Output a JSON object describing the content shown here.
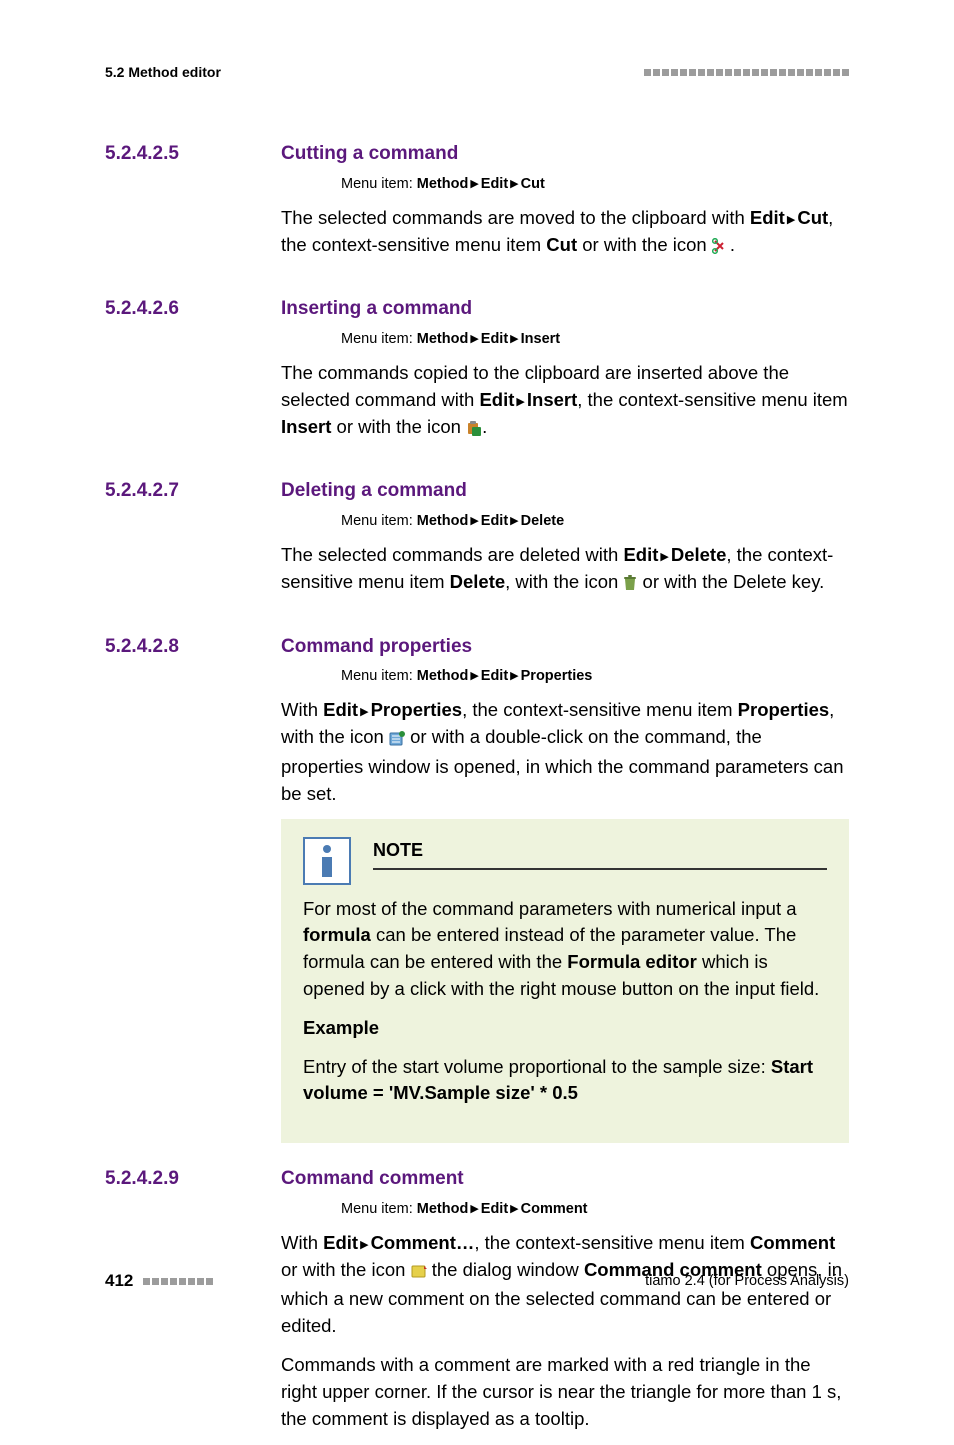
{
  "header": {
    "left": "5.2 Method editor"
  },
  "sections": [
    {
      "num": "5.2.4.2.5",
      "title": "Cutting a command",
      "menu": {
        "prefix": "Menu item:",
        "parts": [
          "Method",
          "Edit",
          "Cut"
        ]
      },
      "p1a": "The selected commands are moved to the clipboard with ",
      "p1b": "Edit",
      "p1c": "Cut",
      "p1d": ", the context-sensitive menu item ",
      "p1e": "Cut",
      "p1f": " or with the icon ",
      "p1g": "."
    },
    {
      "num": "5.2.4.2.6",
      "title": "Inserting a command",
      "menu": {
        "prefix": "Menu item:",
        "parts": [
          "Method",
          "Edit",
          "Insert"
        ]
      },
      "p1a": "The commands copied to the clipboard are inserted above the selected command with ",
      "p1b": "Edit",
      "p1c": "Insert",
      "p1d": ", the context-sensitive menu item ",
      "p1e": "Insert",
      "p1f": " or with the icon ",
      "p1g": "."
    },
    {
      "num": "5.2.4.2.7",
      "title": "Deleting a command",
      "menu": {
        "prefix": "Menu item:",
        "parts": [
          "Method",
          "Edit",
          "Delete"
        ]
      },
      "p1a": "The selected commands are deleted with ",
      "p1b": "Edit",
      "p1c": "Delete",
      "p1d": ", the context-sensitive menu item ",
      "p1e": "Delete",
      "p1f": ", with the icon ",
      "p1g": " or with the Delete key."
    },
    {
      "num": "5.2.4.2.8",
      "title": "Command properties",
      "menu": {
        "prefix": "Menu item:",
        "parts": [
          "Method",
          "Edit",
          "Properties"
        ]
      },
      "p1a": "With ",
      "p1b": "Edit",
      "p1c": "Properties",
      "p1d": ", the context-sensitive menu item ",
      "p1e": "Properties",
      "p1f": ", with the icon ",
      "p1g": " or with a double-click on the command, the properties window is opened, in which the command parameters can be set.",
      "note": {
        "title": "NOTE",
        "body1a": "For most of the command parameters with numerical input a ",
        "body1b": "formula",
        "body1c": " can be entered instead of the parameter value. The formula can be entered with the ",
        "body1d": "Formula editor",
        "body1e": " which is opened by a click with the right mouse button on the input field.",
        "example_label": "Example",
        "example_a": "Entry of the start volume proportional to the sample size: ",
        "example_b": "Start volume = 'MV.Sample size' * 0.5"
      }
    },
    {
      "num": "5.2.4.2.9",
      "title": "Command comment",
      "menu": {
        "prefix": "Menu item:",
        "parts": [
          "Method",
          "Edit",
          "Comment"
        ]
      },
      "p1a": "With ",
      "p1b": "Edit",
      "p1c": "Comment…",
      "p1d": ", the context-sensitive menu item ",
      "p1e": "Comment",
      "p1f": " or with the icon ",
      "p1g": " the dialog window ",
      "p1h": "Command comment",
      "p1i": " opens, in which a new comment on the selected command can be entered or edited.",
      "p2": "Commands with a comment are marked with a red triangle in the right upper corner. If the cursor is near the triangle for more than 1 s, the comment is displayed as a tooltip."
    }
  ],
  "footer": {
    "page": "412",
    "right": "tiamo 2.4 (for Process Analysis)"
  }
}
